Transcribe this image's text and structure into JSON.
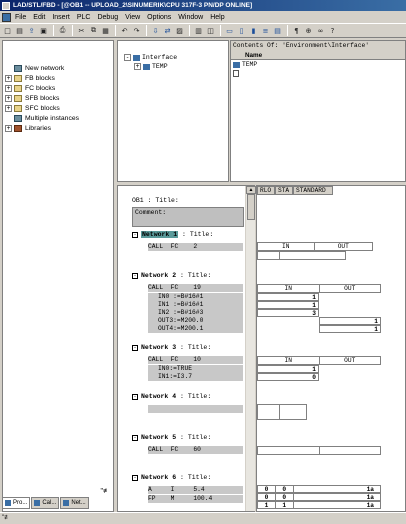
{
  "window": {
    "title": "LAD/STL/FBD - [@OB1 -- UPLOAD_2\\SINUMERIK\\CPU 317F-3 PN/DP  ONLINE]"
  },
  "menu": [
    "File",
    "Edit",
    "Insert",
    "PLC",
    "Debug",
    "View",
    "Options",
    "Window",
    "Help"
  ],
  "tree": [
    {
      "label": "New network",
      "expand": ""
    },
    {
      "label": "FB blocks",
      "expand": "+"
    },
    {
      "label": "FC blocks",
      "expand": "+"
    },
    {
      "label": "SFB blocks",
      "expand": "+"
    },
    {
      "label": "SFC blocks",
      "expand": "+"
    },
    {
      "label": "Multiple instances",
      "expand": ""
    },
    {
      "label": "Libraries",
      "expand": "+"
    }
  ],
  "bottom_tabs": [
    "Pro...",
    "Cal...",
    "Net..."
  ],
  "interface": {
    "root": "Interface",
    "child": "TEMP"
  },
  "contents": {
    "header": "Contents Of: 'Environment\\Interface'",
    "col_name": "Name",
    "rows": [
      "TEMP"
    ]
  },
  "status_header": [
    "RLO",
    "STA",
    "STANDARD"
  ],
  "ob1_title": "OB1 : Title:",
  "comment_label": "Comment:",
  "networks": [
    {
      "label": "Network",
      "num": "1",
      "title": ": Title:",
      "lines": [
        "CALL  FC    2"
      ]
    },
    {
      "label": "Network",
      "num": "2",
      "title": ": Title:",
      "lines": [
        "CALL  FC    19",
        "IN0 :=B#16#1",
        "IN1 :=B#16#1",
        "IN2 :=B#16#3",
        "OUT3:=M200.0",
        "OUT4:=M200.1"
      ]
    },
    {
      "label": "Network",
      "num": "3",
      "title": ": Title:",
      "lines": [
        "CALL  FC    10",
        "IN0:=TRUE",
        "IN1:=I3.7"
      ]
    },
    {
      "label": "Network",
      "num": "4",
      "title": ": Title:",
      "lines": [
        ""
      ]
    },
    {
      "label": "Network",
      "num": "5",
      "title": ": Title:",
      "lines": [
        "CALL  FC    60"
      ]
    },
    {
      "label": "Network",
      "num": "6",
      "title": ": Title:",
      "lines": [
        "A     I     5.4",
        "FP    M     100.4"
      ]
    }
  ],
  "status_cols": {
    "in": "IN",
    "out": "OUT"
  },
  "status_values": {
    "n2": [
      "1",
      "1",
      "3",
      "1",
      "1"
    ],
    "n3": [
      "1",
      "0"
    ],
    "n6": [
      [
        "0",
        "0",
        "1a"
      ],
      [
        "0",
        "0",
        "1a"
      ],
      [
        "1",
        "1",
        "1a"
      ]
    ]
  },
  "misc": {
    "corner_label": "\"≢",
    "tb_zoom": "▾"
  }
}
